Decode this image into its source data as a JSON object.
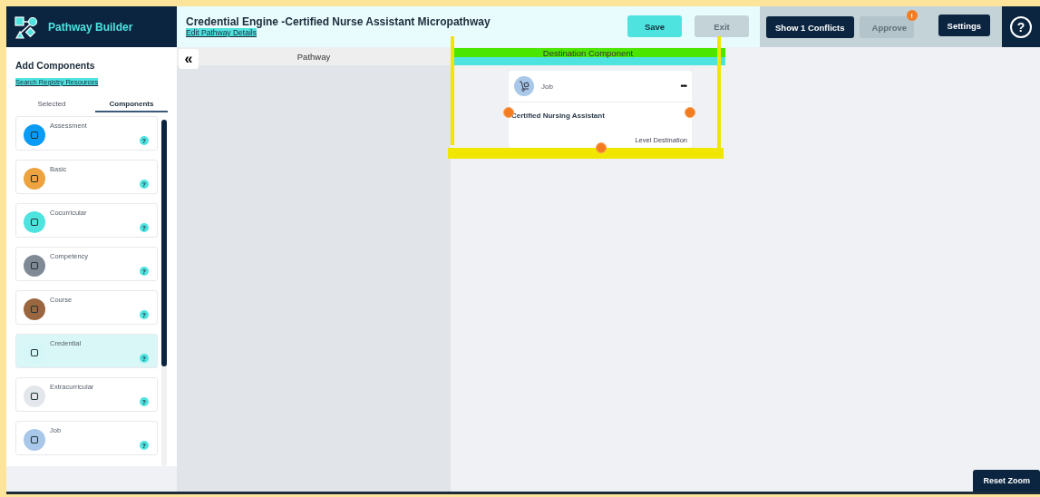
{
  "app": {
    "title": "Pathway Builder"
  },
  "header": {
    "title": "Credential Engine -Certified Nurse Assistant Micropathway",
    "edit_link": "Edit Pathway Details"
  },
  "toolbar": {
    "save": {
      "label": "Save",
      "disabled": false
    },
    "exit": {
      "label": "Exit",
      "disabled": true
    },
    "conflicts": "Show 1 Conflicts",
    "approve": {
      "label": "Approve",
      "disabled": true,
      "badge": "!"
    },
    "settings": "Settings",
    "help": "?"
  },
  "sidebar": {
    "title": "Add Components",
    "search_link": "Search Registry Resources",
    "collapse": "«",
    "tabs": [
      {
        "label": "Selected",
        "selected": false
      },
      {
        "label": "Components",
        "selected": true
      }
    ],
    "items": [
      {
        "label": "Assessment",
        "color": "#0a9bf5",
        "selected": false,
        "help": "?"
      },
      {
        "label": "Basic",
        "color": "#eda33f",
        "selected": false,
        "help": "?"
      },
      {
        "label": "Cocurricular",
        "color": "#4fe3e0",
        "selected": false,
        "help": "?"
      },
      {
        "label": "Competency",
        "color": "#808a96",
        "selected": false,
        "help": "?"
      },
      {
        "label": "Course",
        "color": "#9a6640",
        "selected": false,
        "help": "?"
      },
      {
        "label": "Credential",
        "color": "#d6f7f7",
        "selected": true,
        "help": "?"
      },
      {
        "label": "Extracurricular",
        "color": "#e3e6ea",
        "selected": false,
        "help": "?"
      },
      {
        "label": "Job",
        "color": "#a9c7e8",
        "selected": false,
        "help": "?"
      }
    ]
  },
  "columns": [
    {
      "label": "Pathway"
    },
    {
      "label": "Destination Component"
    }
  ],
  "destination_card": {
    "type": "Job",
    "menu": "•••",
    "title": "Certified Nursing Assistant",
    "level": "Level Destination"
  },
  "reset_zoom": "Reset Zoom"
}
